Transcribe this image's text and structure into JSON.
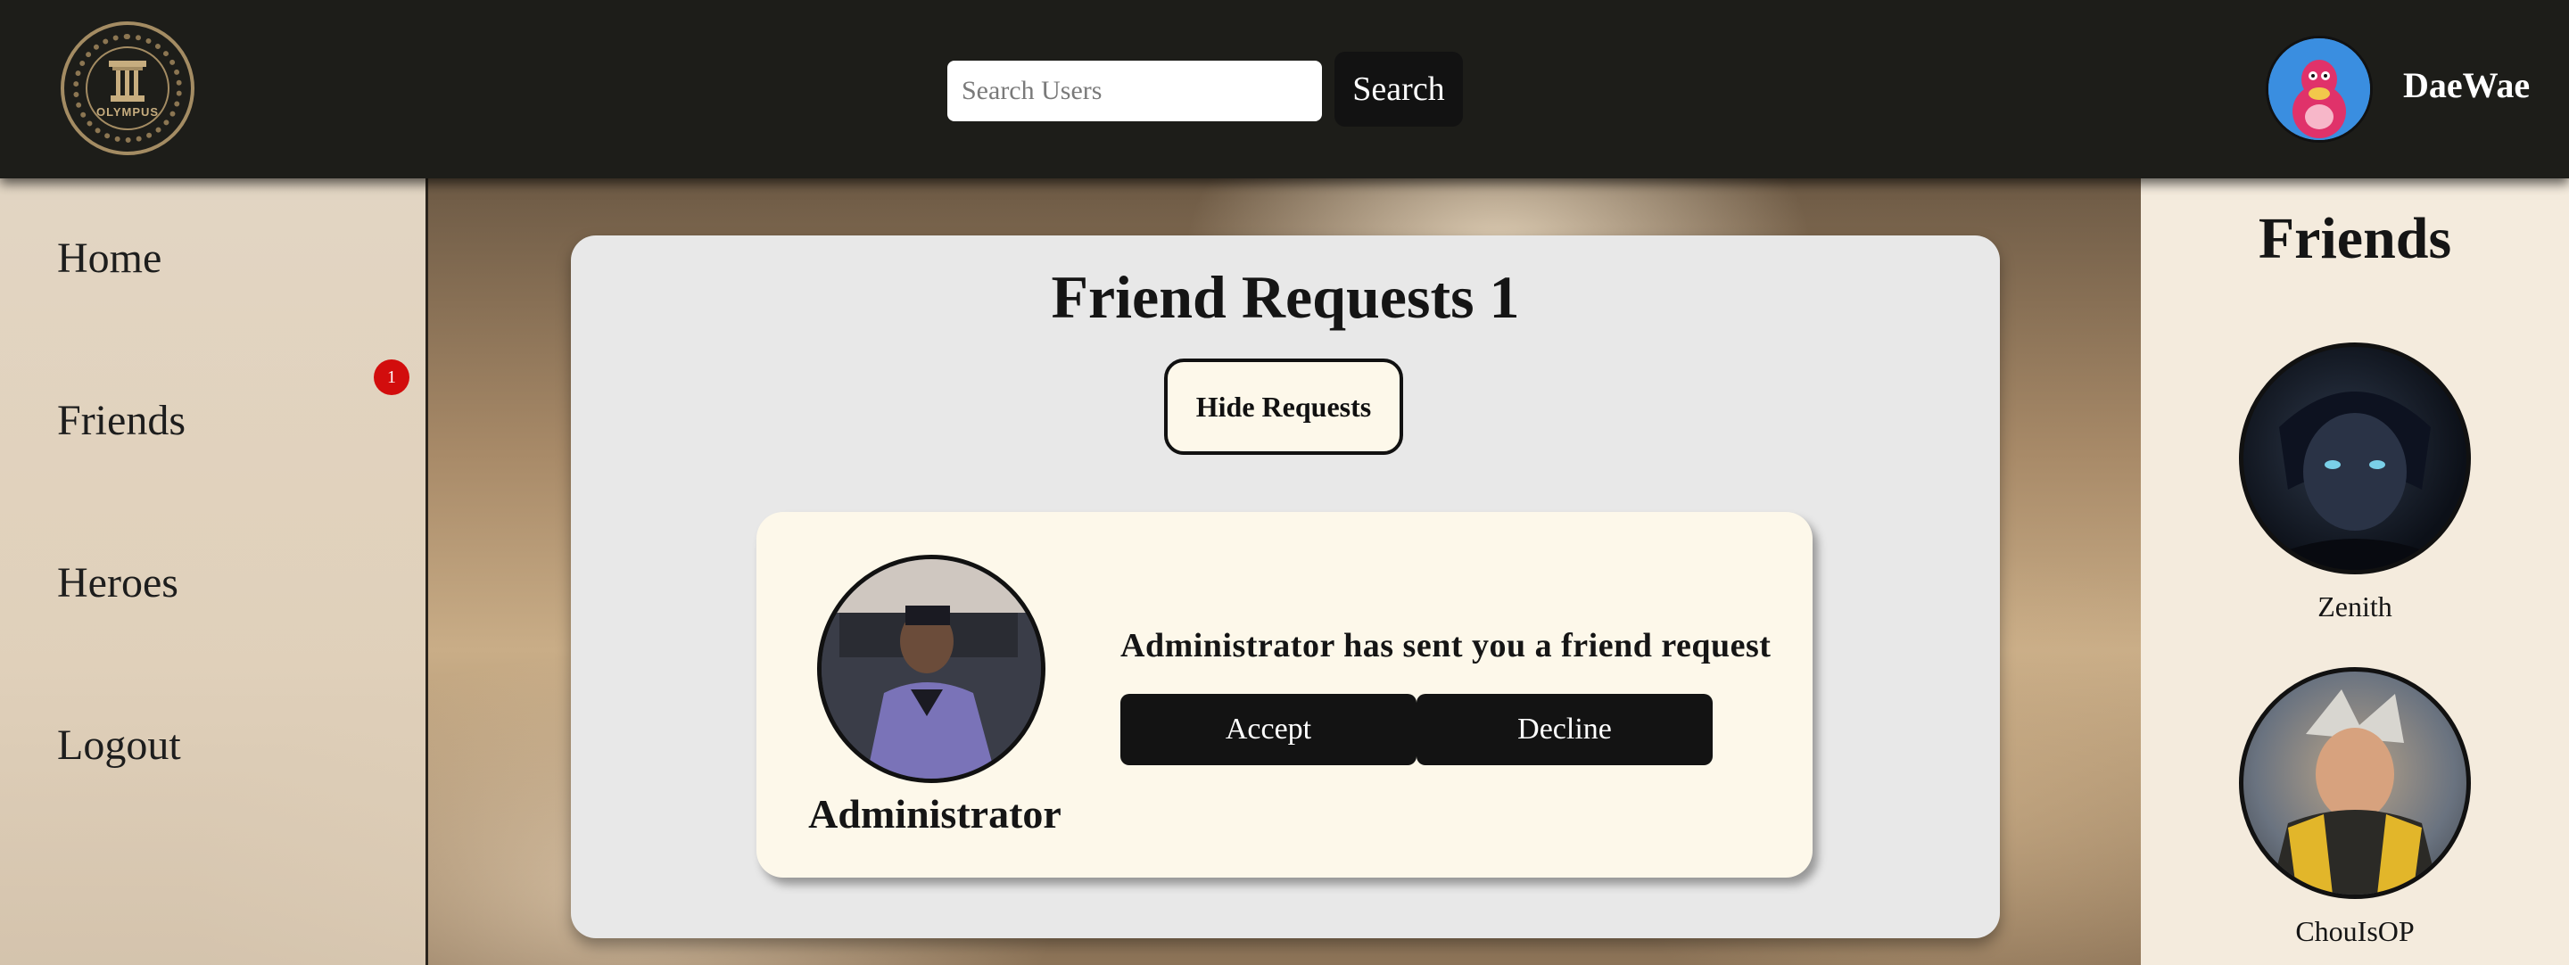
{
  "header": {
    "logo_text": "OLYMPUS",
    "search": {
      "placeholder": "Search Users",
      "value": "",
      "button_label": "Search"
    },
    "user": {
      "name": "DaeWae"
    }
  },
  "sidebar": {
    "items": [
      {
        "label": "Home"
      },
      {
        "label": "Friends",
        "badge": "1"
      },
      {
        "label": "Heroes"
      },
      {
        "label": "Logout"
      }
    ]
  },
  "main": {
    "title": "Friend Requests 1",
    "hide_button_label": "Hide Requests",
    "requests": [
      {
        "name": "Administrator",
        "message": "Administrator has sent you a friend request",
        "accept_label": "Accept",
        "decline_label": "Decline"
      }
    ]
  },
  "friends_panel": {
    "title": "Friends",
    "friends": [
      {
        "name": "Zenith"
      },
      {
        "name": "ChouIsOP"
      }
    ]
  },
  "colors": {
    "header_bg": "#1d1d19",
    "panel_bg": "#e8e8e8",
    "card_bg": "#fdf8ea",
    "button_bg": "#131313",
    "badge_bg": "#d20d0d",
    "friends_bg": "#f4ebdd"
  }
}
